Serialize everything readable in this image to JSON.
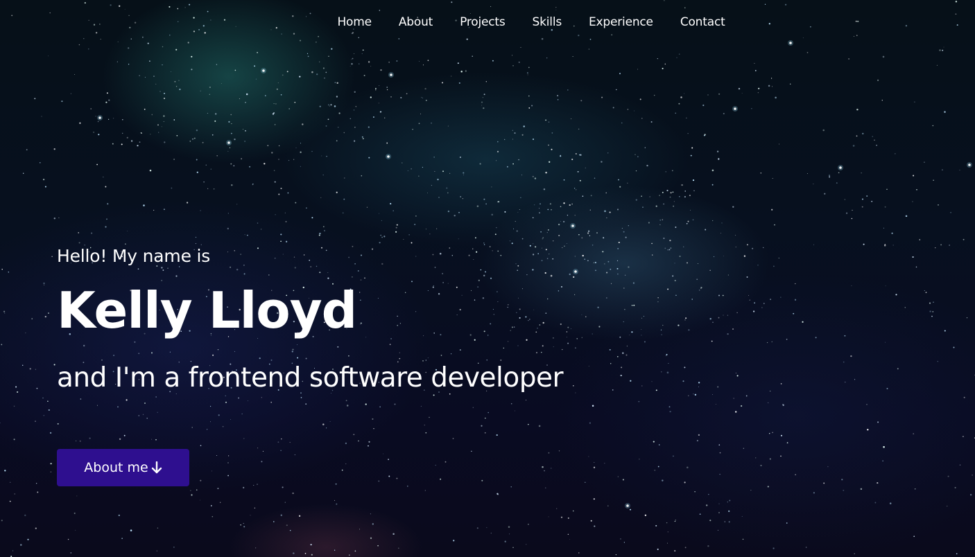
{
  "nav": {
    "items": [
      {
        "label": "Home"
      },
      {
        "label": "About"
      },
      {
        "label": "Projects"
      },
      {
        "label": "Skills"
      },
      {
        "label": "Experience"
      },
      {
        "label": "Contact"
      }
    ]
  },
  "hero": {
    "greeting": "Hello! My name is",
    "name": "Kelly Lloyd",
    "tagline": "and I'm a frontend software developer",
    "button_label": "About me",
    "button_icon": "arrow-down-icon"
  },
  "colors": {
    "button_bg": "#2e0f8f",
    "text": "#ffffff",
    "background": "#07101f"
  }
}
